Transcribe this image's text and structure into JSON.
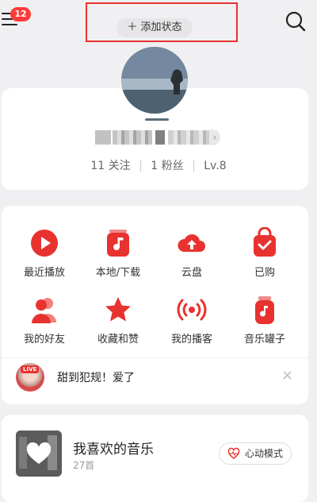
{
  "header": {
    "notification_count": "12",
    "status_button_label": "＋ 添加状态",
    "search_icon": "search-icon",
    "menu_icon": "hamburger-menu-icon"
  },
  "profile": {
    "username_chevron": "›",
    "stats": {
      "following": "11 关注",
      "followers": "1 粉丝",
      "level": "Lv.8"
    }
  },
  "shortcuts": [
    {
      "label": "最近播放",
      "icon": "play-icon"
    },
    {
      "label": "本地/下载",
      "icon": "music-note-icon"
    },
    {
      "label": "云盘",
      "icon": "cloud-upload-icon"
    },
    {
      "label": "已购",
      "icon": "shopping-bag-icon"
    },
    {
      "label": "我的好友",
      "icon": "friends-icon"
    },
    {
      "label": "收藏和赞",
      "icon": "star-icon"
    },
    {
      "label": "我的播客",
      "icon": "broadcast-icon"
    },
    {
      "label": "音乐罐子",
      "icon": "music-jar-icon"
    }
  ],
  "live_banner": {
    "tag": "LIVE",
    "text": "甜到犯规！爱了",
    "close": "×"
  },
  "favorites": {
    "title": "我喜欢的音乐",
    "count": "27首",
    "mode_button": "心动模式"
  },
  "colors": {
    "accent": "#e8322f",
    "badge": "#ff3a3a",
    "background": "#f0f0f2"
  }
}
